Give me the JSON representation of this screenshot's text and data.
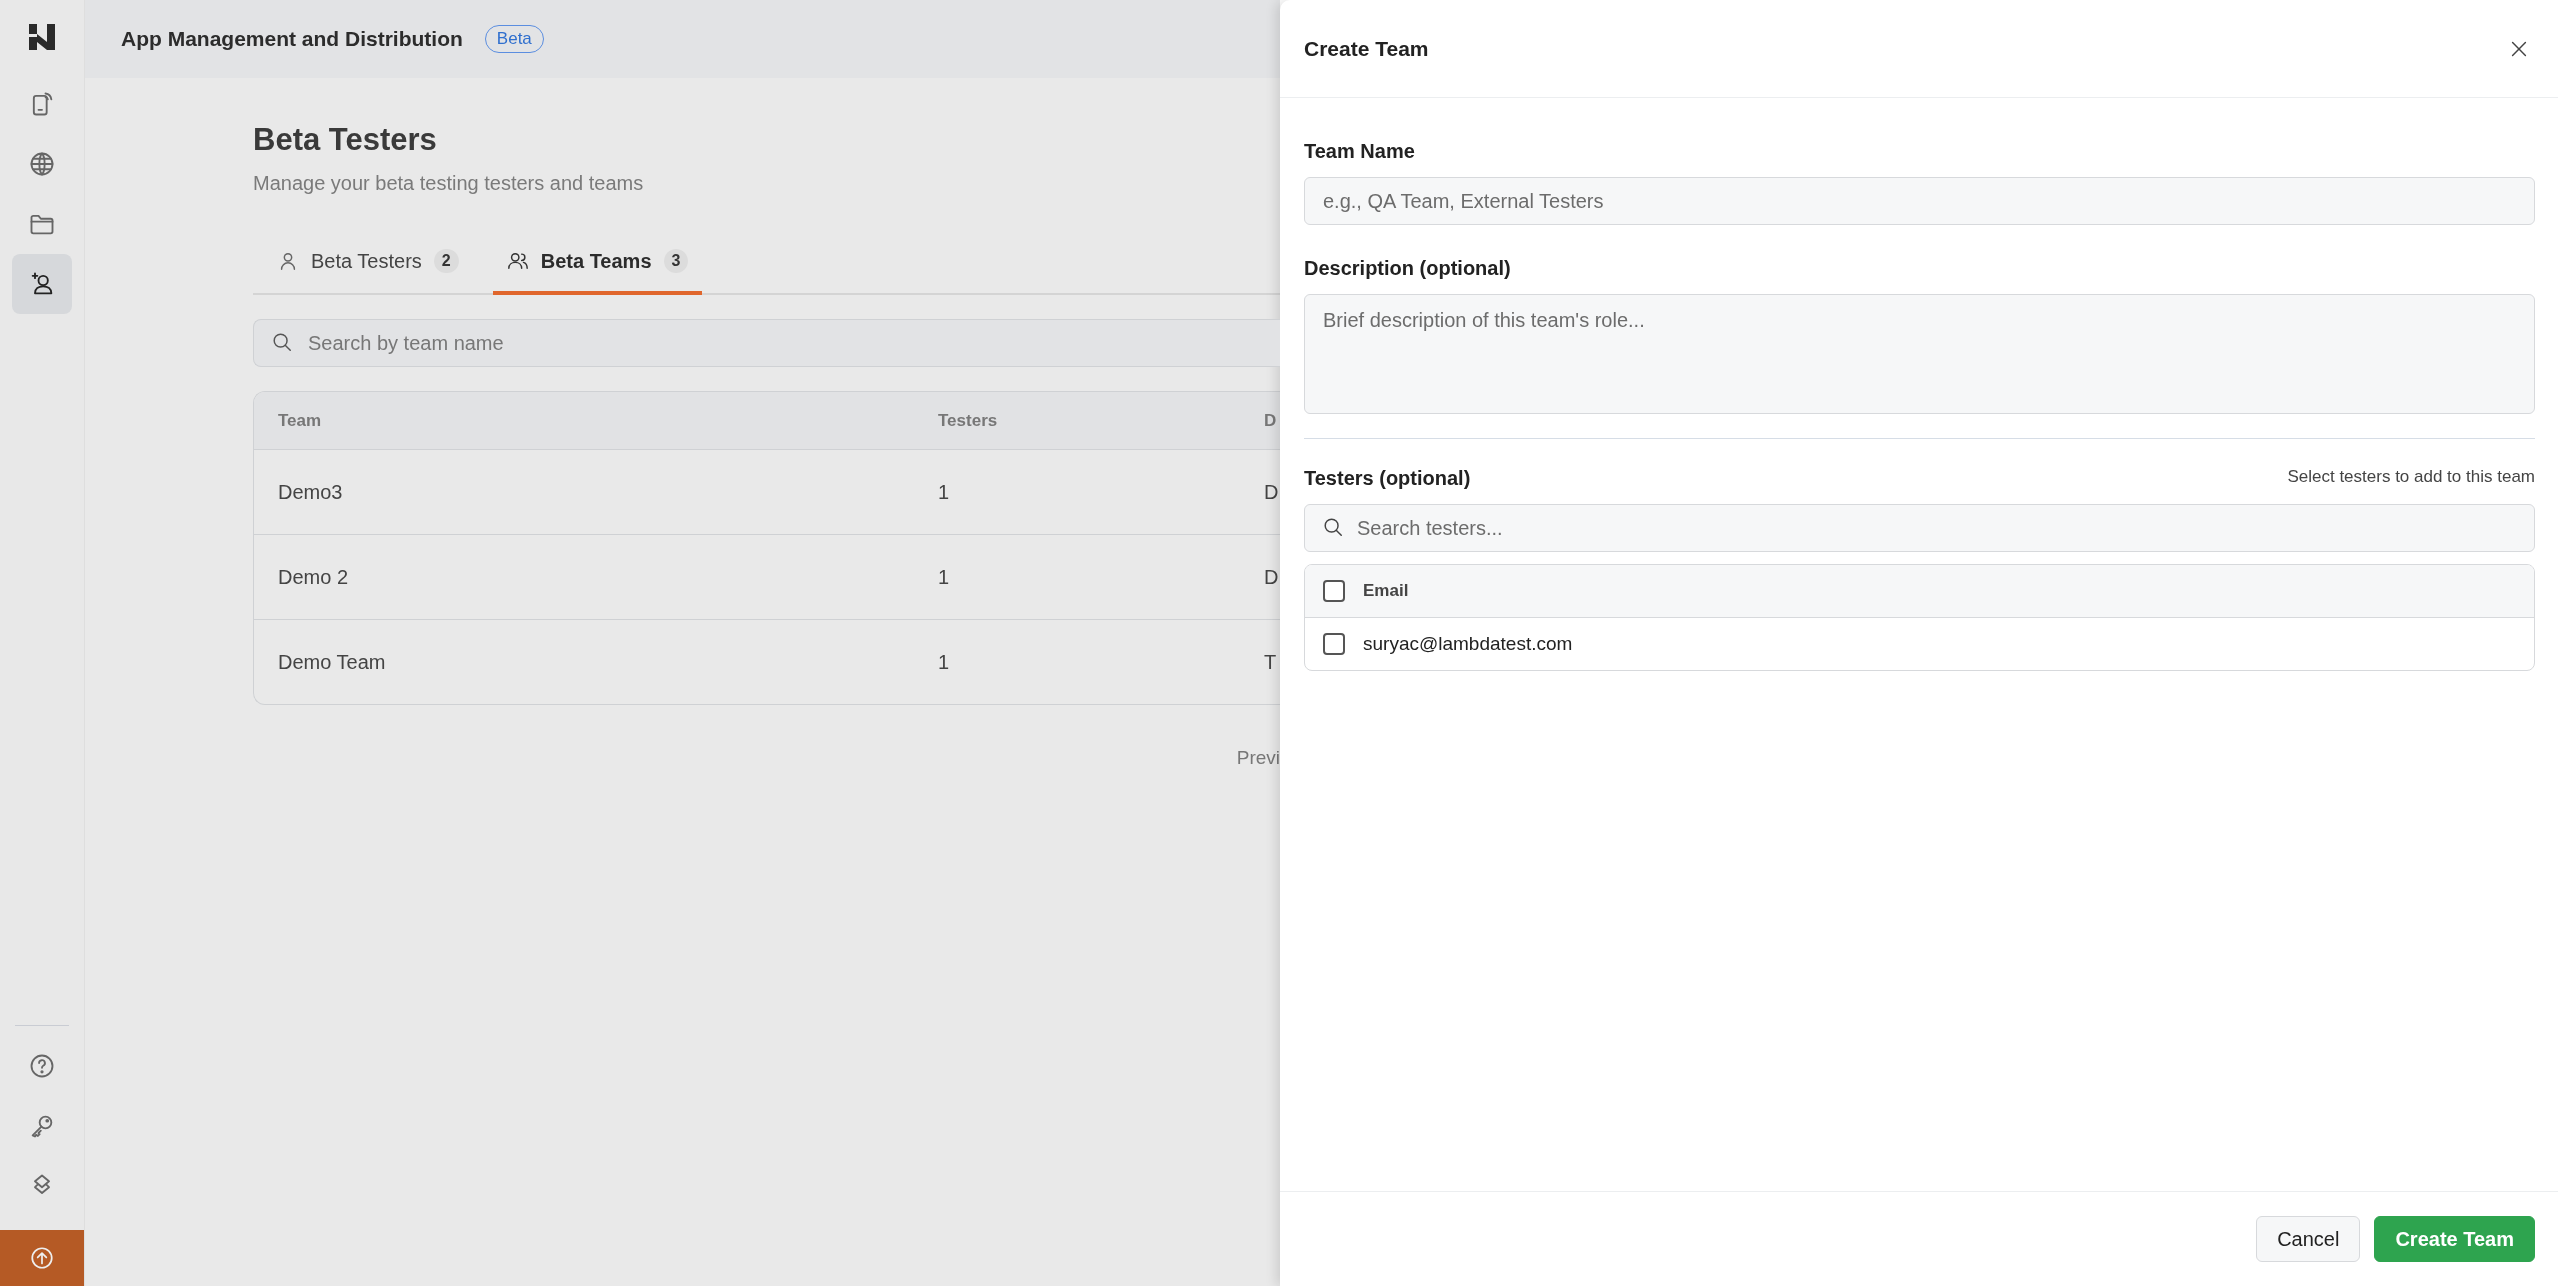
{
  "sidebar": {
    "nav_items": [
      {
        "selected": false
      },
      {
        "selected": false
      },
      {
        "selected": false
      },
      {
        "selected": true
      }
    ],
    "bottom_items": [
      {
        "kind": "help"
      },
      {
        "kind": "key"
      },
      {
        "kind": "layers"
      }
    ],
    "upload": {
      "kind": "upload"
    }
  },
  "header": {
    "title": "App Management and Distribution",
    "badge": "Beta"
  },
  "page": {
    "title": "Beta Testers",
    "subtitle": "Manage your beta testing testers and teams"
  },
  "tabs": [
    {
      "label": "Beta Testers",
      "count": "2",
      "kind": "person",
      "selected": false
    },
    {
      "label": "Beta Teams",
      "count": "3",
      "kind": "people",
      "selected": true
    }
  ],
  "search": {
    "placeholder": "Search by team name"
  },
  "table": {
    "columns": [
      "Team",
      "Testers",
      "D"
    ],
    "rows": [
      [
        "Demo3",
        "1",
        "D"
      ],
      [
        "Demo 2",
        "1",
        "D"
      ],
      [
        "Demo Team",
        "1",
        "T"
      ]
    ]
  },
  "pagination": {
    "previous": "Previ"
  },
  "drawer": {
    "title": "Create Team",
    "fields": [
      {
        "label": "Team Name",
        "kind": "input",
        "placeholder": "e.g., QA Team, External Testers"
      },
      {
        "label": "Description (optional)",
        "kind": "textarea",
        "placeholder": "Brief description of this team's role..."
      }
    ],
    "testers": {
      "label": "Testers (optional)",
      "hint": "Select testers to add to this team",
      "search_placeholder": "Search testers...",
      "column": "Email",
      "header_checked": false,
      "rows": [
        {
          "email": "suryac@lambdatest.com",
          "checked": false
        }
      ]
    },
    "buttons": [
      {
        "label": "Cancel",
        "kind": "secondary"
      },
      {
        "label": "Create Team",
        "kind": "primary"
      }
    ]
  }
}
